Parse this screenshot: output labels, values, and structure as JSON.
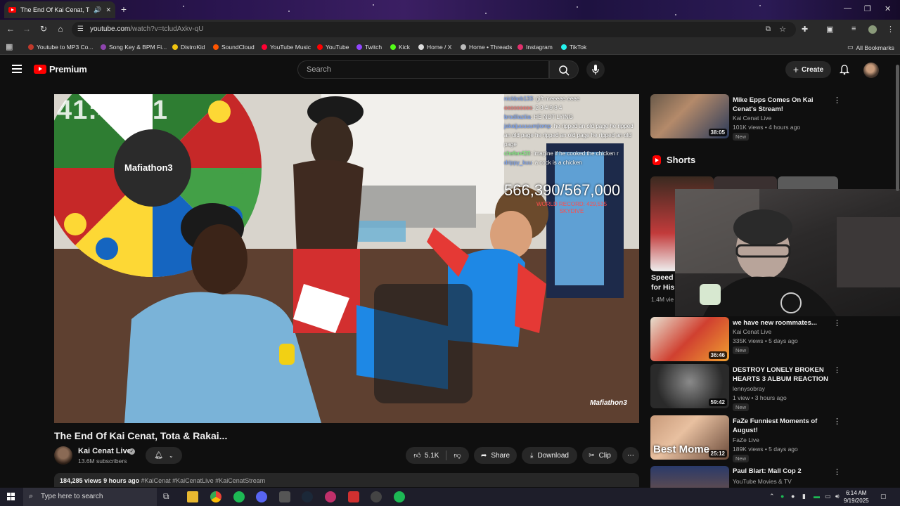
{
  "browser": {
    "tab_title": "The End Of Kai Cenat, Tota",
    "url_host": "youtube.com",
    "url_path": "/watch?v=tcludAxkv-qU",
    "bookmarks": [
      "Youtube to MP3 Co...",
      "Song Key & BPM Fi...",
      "DistroKid",
      "SoundCloud",
      "YouTube Music",
      "YouTube",
      "Twitch",
      "Kick",
      "Home / X",
      "Home • Threads",
      "Instagram",
      "TikTok"
    ],
    "all_bookmarks": "All Bookmarks"
  },
  "header": {
    "logo_text": "Premium",
    "search_placeholder": "Search",
    "create_label": "Create"
  },
  "video": {
    "timer": "41:47:11",
    "counter": "566,390/567,000",
    "record_line1": "WORLD RECORD: 429,535",
    "record_line2": "SKYDIVE",
    "watermark": "Mafiathon3",
    "wheel_label": "Mafiathon3",
    "chat": [
      {
        "user": "nickbob133",
        "msg": "gift meeeee eeee"
      },
      {
        "user": "ooooooooo",
        "msg": "2 3 4 9 8 4"
      },
      {
        "user": "brodilaziiia",
        "msg": "HE NOT LYING"
      },
      {
        "user": "jakaijuuuuumjiomp",
        "msg": "he ripped an old page he ripped an old page he ripped an old page he ripped an old page"
      },
      {
        "user": "chefen420",
        "msg": "imagine if he cooked the chicken r"
      },
      {
        "user": "drippy_kuu",
        "msg": "a cock is a chicken"
      }
    ],
    "title": "The End Of Kai Cenat, Tota & Rakai...",
    "channel": "Kai Cenat Live",
    "subscribers": "13.6M subscribers",
    "likes": "5.1K",
    "share_label": "Share",
    "download_label": "Download",
    "clip_label": "Clip",
    "views": "184,285 views",
    "age": "9 hours ago",
    "tags": "#KaiCenat #KaiCenatLive #KaiCenatStream"
  },
  "sidebar": {
    "recs": [
      {
        "title": "Mike Epps Comes On Kai Cenat's Stream!",
        "channel": "Kai Cenat Live",
        "meta": "101K views • 4 hours ago",
        "badge": "New",
        "duration": "38:05"
      },
      {
        "title": "we have new roommates...",
        "channel": "Kai Cenat Live",
        "meta": "335K views • 5 days ago",
        "badge": "New",
        "duration": "36:46"
      },
      {
        "title": "DESTROY LONELY BROKEN HEARTS 3 ALBUM REACTION",
        "channel": "lennysobray",
        "meta": "1 view • 3 hours ago",
        "badge": "New",
        "duration": "59:42"
      },
      {
        "title": "FaZe Funniest Moments of August!",
        "channel": "FaZe Live",
        "meta": "189K views • 5 days ago",
        "badge": "New",
        "duration": "25:12"
      },
      {
        "title": "Paul Blart: Mall Cop 2",
        "channel": "YouTube Movies & TV",
        "meta": "",
        "badge": "",
        "duration": ""
      }
    ],
    "shorts_heading": "Shorts",
    "short1_title_1": "Speed",
    "short1_title_2": "for His",
    "short1_views": "1.4M vie"
  },
  "taskbar": {
    "search_placeholder": "Type here to search",
    "time": "6:14 AM",
    "date": "9/19/2025"
  }
}
